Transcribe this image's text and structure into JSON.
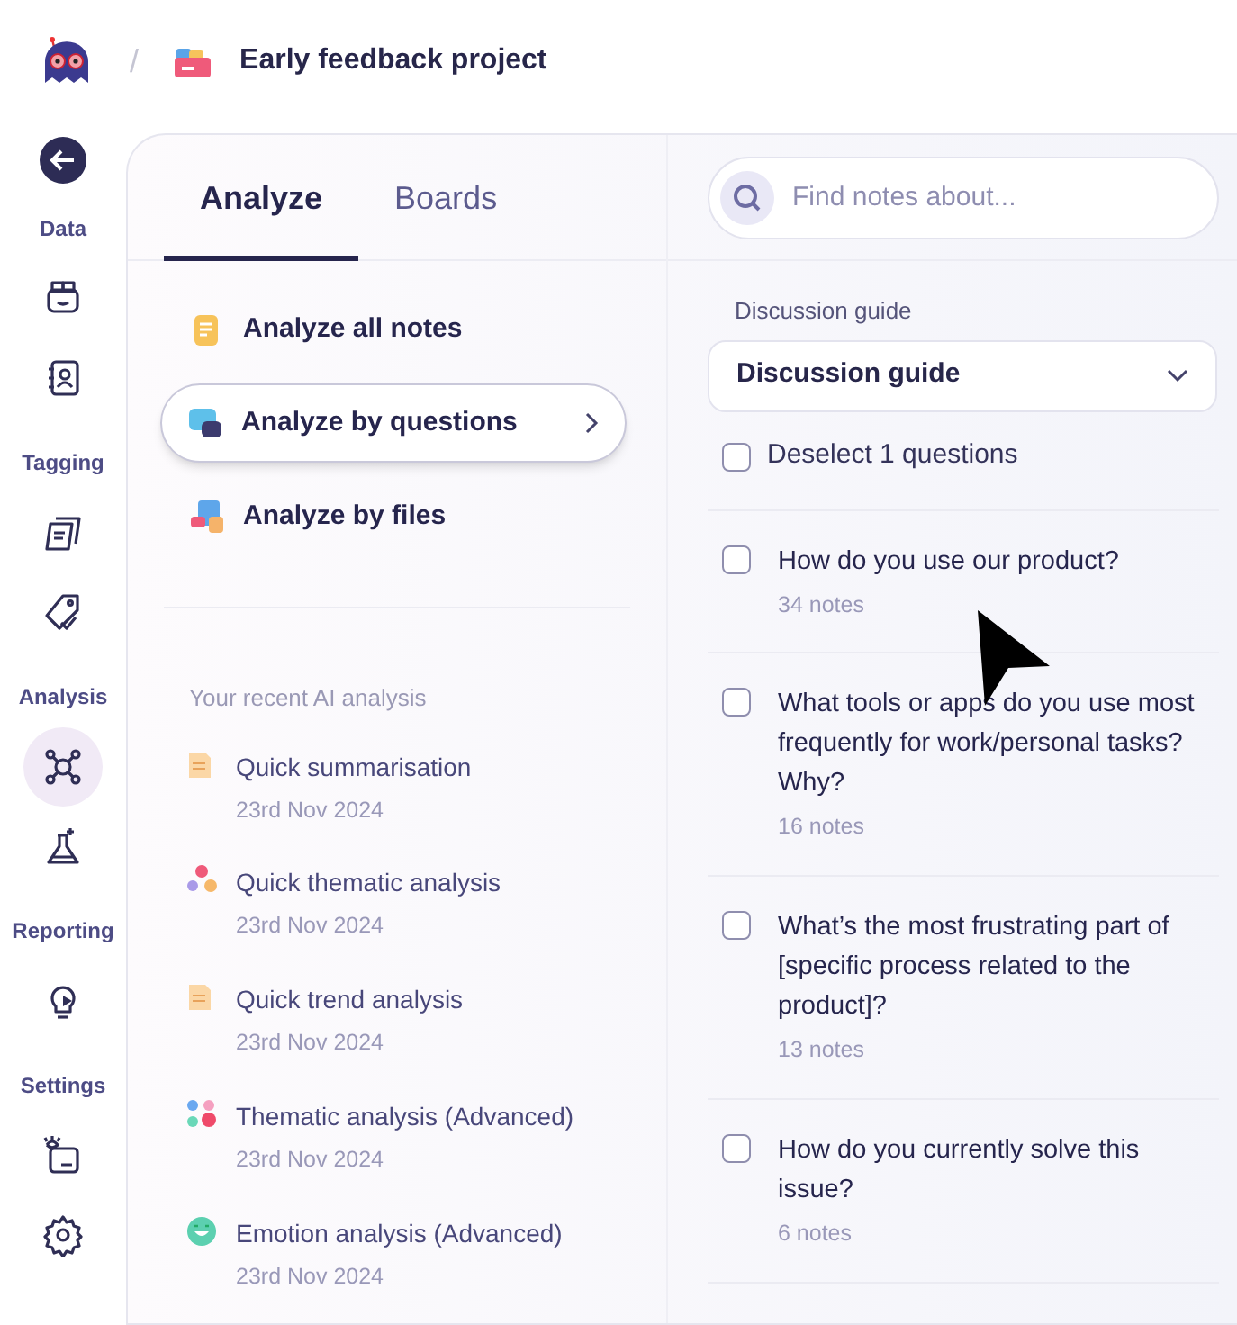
{
  "header": {
    "separator": "/",
    "project": "Early feedback project"
  },
  "sidebar": {
    "sections": [
      {
        "label": "Data",
        "items": [
          {
            "kind": "folder",
            "selected": false
          },
          {
            "kind": "contacts",
            "selected": false
          }
        ]
      },
      {
        "label": "Tagging",
        "items": [
          {
            "kind": "notes",
            "selected": false
          },
          {
            "kind": "tag",
            "selected": false
          }
        ]
      },
      {
        "label": "Analysis",
        "items": [
          {
            "kind": "network",
            "selected": true
          },
          {
            "kind": "flask",
            "selected": false
          }
        ]
      },
      {
        "label": "Reporting",
        "items": [
          {
            "kind": "bulb",
            "selected": false
          }
        ]
      },
      {
        "label": "Settings",
        "items": [
          {
            "kind": "eye",
            "selected": false
          },
          {
            "kind": "gear",
            "selected": false
          }
        ]
      }
    ]
  },
  "tabs": [
    {
      "label": "Analyze",
      "selected": true
    },
    {
      "label": "Boards",
      "selected": false
    }
  ],
  "search": {
    "placeholder": "Find notes about..."
  },
  "modes": [
    {
      "label": "Analyze all notes",
      "kind": "note",
      "selected": false
    },
    {
      "label": "Analyze by questions",
      "kind": "question",
      "selected": true
    },
    {
      "label": "Analyze by files",
      "kind": "files",
      "selected": false
    }
  ],
  "recent": {
    "heading": "Your recent AI analysis",
    "items": [
      {
        "kind": "doc",
        "title": "Quick summarisation",
        "date": "23rd Nov 2024"
      },
      {
        "kind": "dots3",
        "title": "Quick thematic analysis",
        "date": "23rd Nov 2024"
      },
      {
        "kind": "doc",
        "title": "Quick trend analysis",
        "date": "23rd Nov 2024"
      },
      {
        "kind": "dots4",
        "title": "Thematic analysis (Advanced)",
        "date": "23rd Nov 2024"
      },
      {
        "kind": "emoji",
        "title": "Emotion analysis (Advanced)",
        "date": "23rd Nov 2024"
      }
    ]
  },
  "guide": {
    "label": "Discussion guide",
    "value": "Discussion guide"
  },
  "deselect": {
    "label": "Deselect 1 questions",
    "checked": false
  },
  "questions": [
    {
      "text": "How do you use our product?",
      "count": "34 notes",
      "checked": false
    },
    {
      "text": "What tools or apps do you use most frequently for work/personal tasks? Why?",
      "count": "16 notes",
      "checked": false
    },
    {
      "text": "What’s the most frustrating part of [specific process related to the product]?",
      "count": "13 notes",
      "checked": false
    },
    {
      "text": "How do you currently solve this issue?",
      "count": "6 notes",
      "checked": false
    }
  ]
}
